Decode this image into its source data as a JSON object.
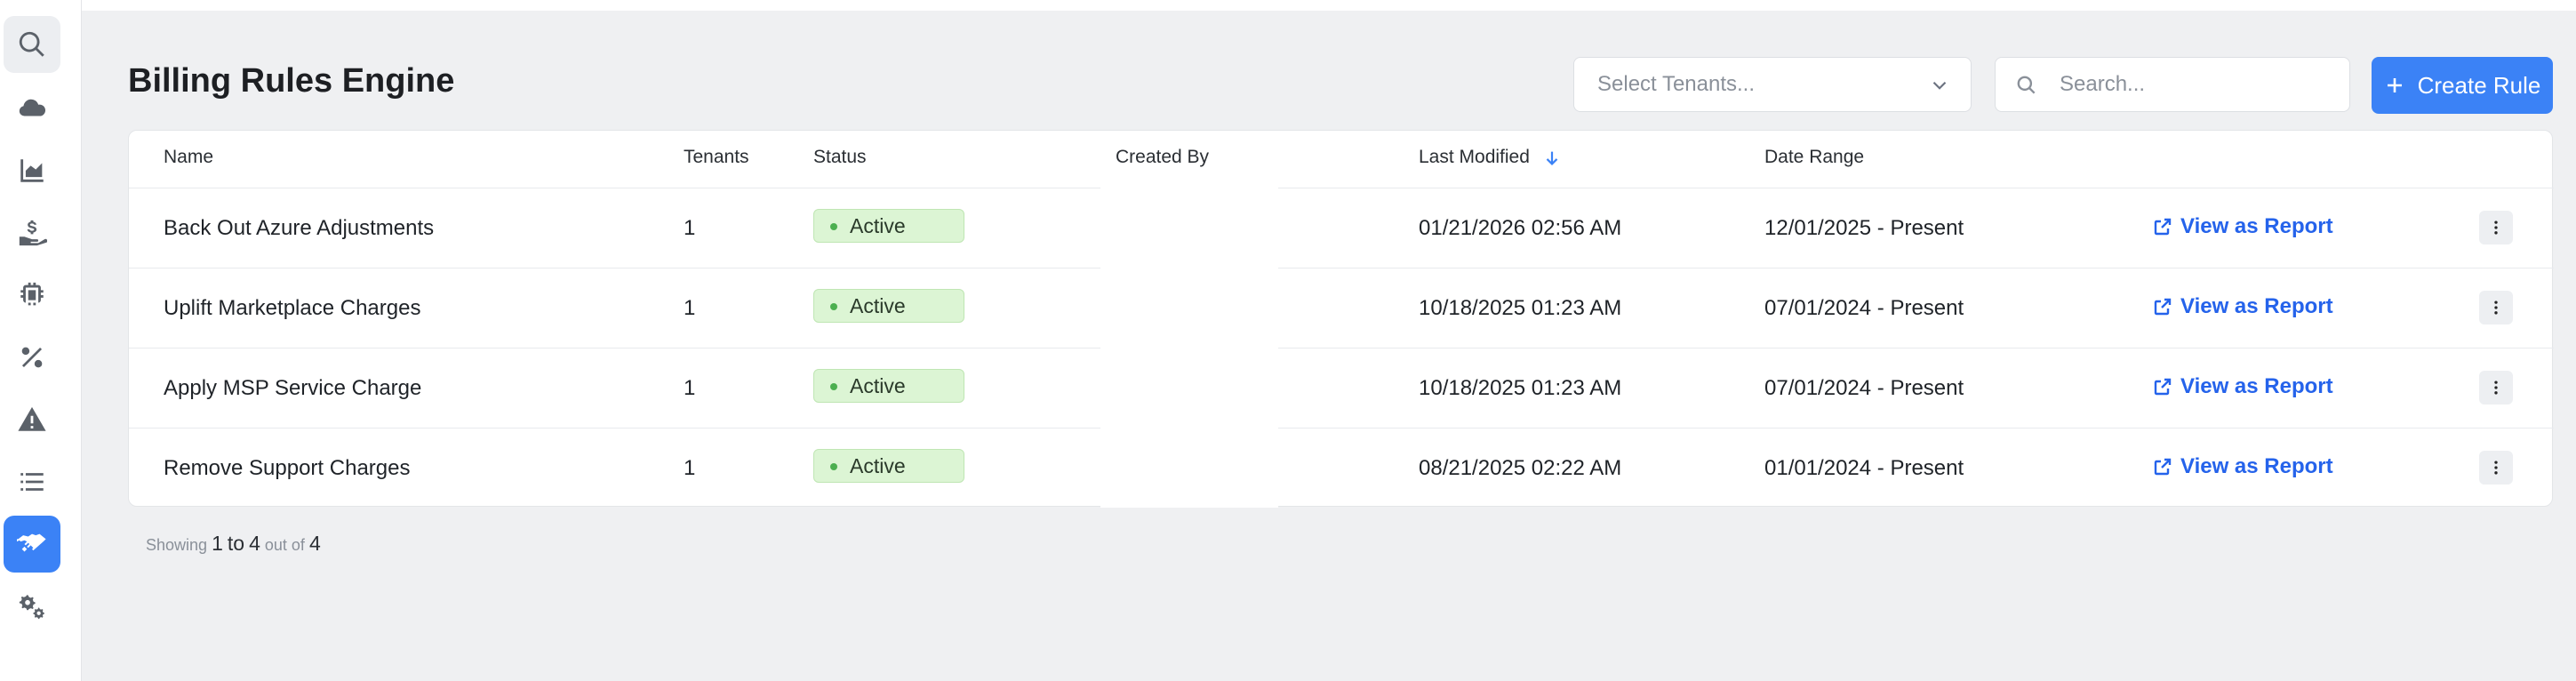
{
  "header": {
    "title": "Billing Rules Engine",
    "tenant_select_placeholder": "Select Tenants...",
    "search_placeholder": "Search...",
    "create_label": "Create Rule"
  },
  "sidebar": {
    "items": [
      {
        "icon": "search-icon"
      },
      {
        "icon": "cloud-icon"
      },
      {
        "icon": "area-chart-icon"
      },
      {
        "icon": "hand-dollar-icon"
      },
      {
        "icon": "chip-icon"
      },
      {
        "icon": "percent-icon"
      },
      {
        "icon": "warning-icon"
      },
      {
        "icon": "list-icon"
      },
      {
        "icon": "handshake-icon",
        "active": true
      },
      {
        "icon": "gears-icon"
      }
    ]
  },
  "table": {
    "columns": [
      "Name",
      "Tenants",
      "Status",
      "Created By",
      "Last Modified",
      "Date Range"
    ],
    "sort_column": "Last Modified",
    "sort_direction": "desc",
    "rows": [
      {
        "name": "Back Out Azure Adjustments",
        "tenants": "1",
        "status": "Active",
        "created_by": "",
        "last_modified": "01/21/2026 02:56 AM",
        "date_range": "12/01/2025 - Present",
        "action": "View as Report"
      },
      {
        "name": "Uplift Marketplace Charges",
        "tenants": "1",
        "status": "Active",
        "created_by": "",
        "last_modified": "10/18/2025 01:23 AM",
        "date_range": "07/01/2024 - Present",
        "action": "View as Report"
      },
      {
        "name": "Apply MSP Service Charge",
        "tenants": "1",
        "status": "Active",
        "created_by": "",
        "last_modified": "10/18/2025 01:23 AM",
        "date_range": "07/01/2024 - Present",
        "action": "View as Report"
      },
      {
        "name": "Remove Support Charges",
        "tenants": "1",
        "status": "Active",
        "created_by": "",
        "last_modified": "08/21/2025 02:22 AM",
        "date_range": "01/01/2024 - Present",
        "action": "View as Report"
      }
    ]
  },
  "footer": {
    "showing_label": "Showing",
    "from": "1",
    "to_label": "to",
    "to": "4",
    "out_of_label": "out of",
    "total": "4"
  },
  "colors": {
    "accent": "#3b82f6",
    "link": "#2563eb",
    "status_bg": "#dcf5d4",
    "status_dot": "#4caf50"
  }
}
